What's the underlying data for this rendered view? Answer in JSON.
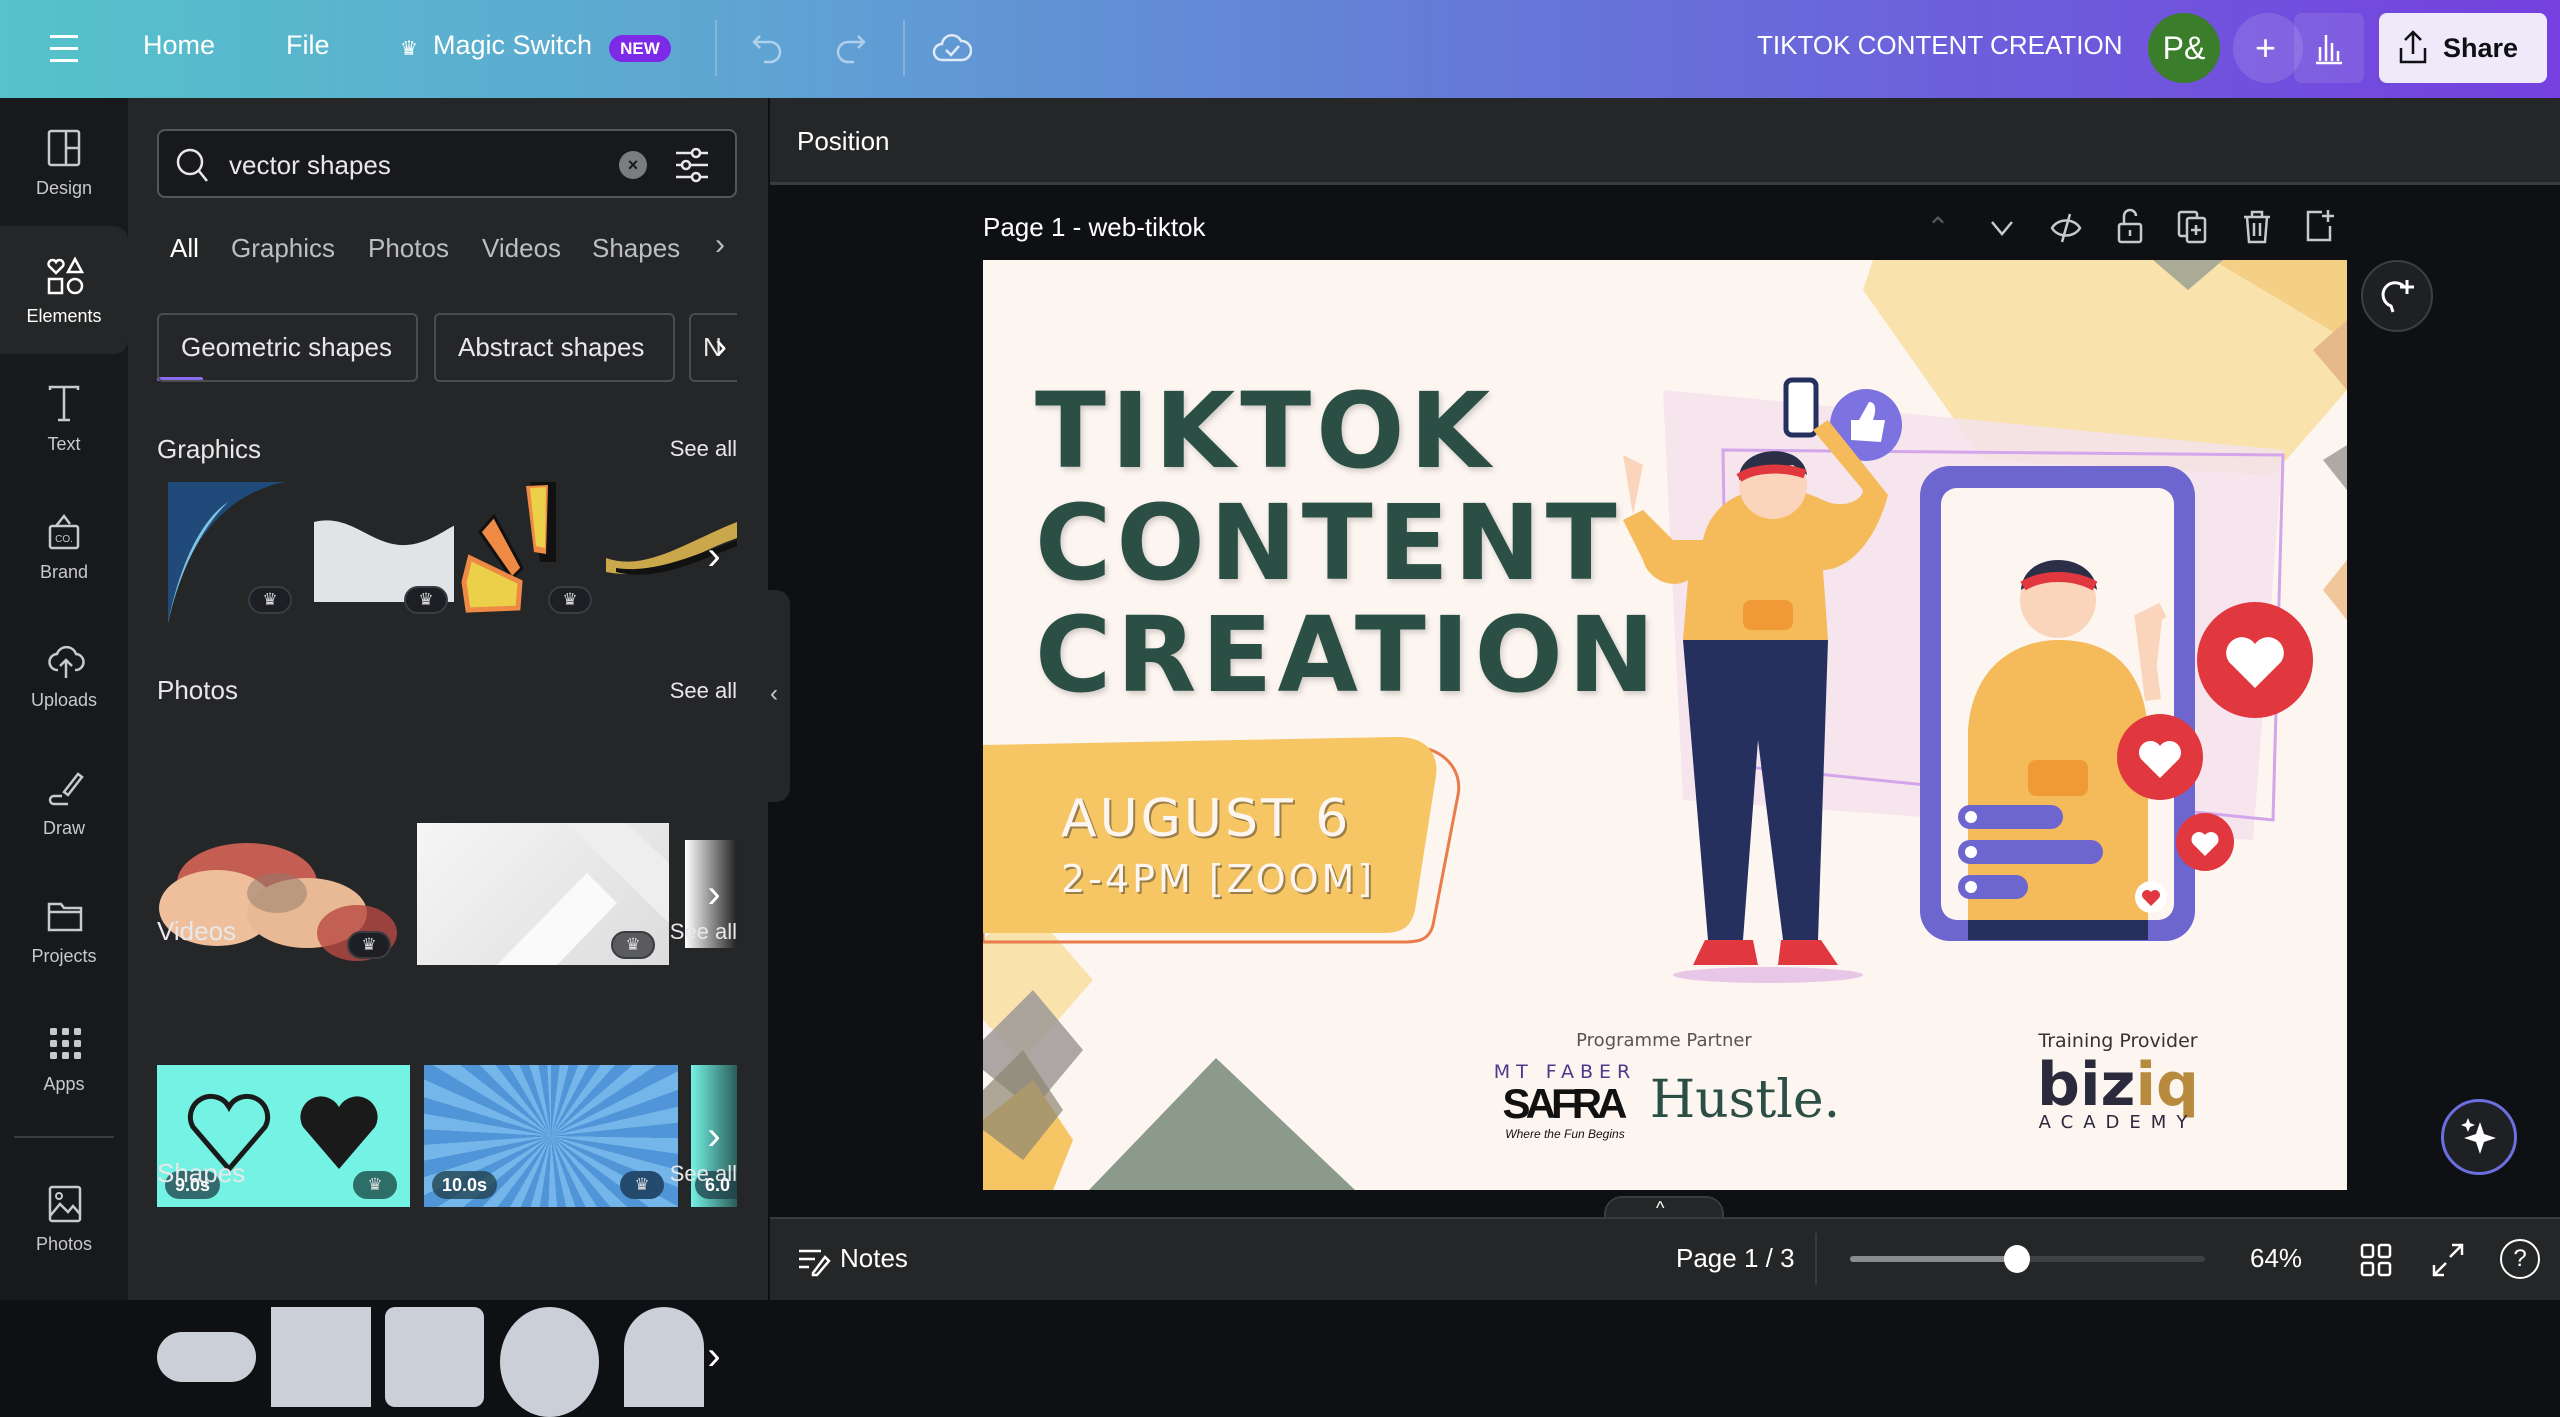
{
  "topbar": {
    "home": "Home",
    "file": "File",
    "magic_switch": "Magic Switch",
    "new_badge": "NEW",
    "document_title": "TIKTOK CONTENT CREATION",
    "avatar_initials": "P&",
    "share": "Share",
    "colors": {
      "gradient_start": "#55c3c9",
      "gradient_end": "#7540df",
      "avatar": "#3a7d2a",
      "share_bg": "#efe9fa"
    }
  },
  "rail": {
    "items": [
      {
        "label": "Design",
        "icon": "layout-icon"
      },
      {
        "label": "Elements",
        "icon": "shapes-icon",
        "active": true
      },
      {
        "label": "Text",
        "icon": "text-icon"
      },
      {
        "label": "Brand",
        "icon": "brand-icon"
      },
      {
        "label": "Uploads",
        "icon": "cloud-upload-icon"
      },
      {
        "label": "Draw",
        "icon": "pen-icon"
      },
      {
        "label": "Projects",
        "icon": "folder-icon"
      },
      {
        "label": "Apps",
        "icon": "apps-grid-icon"
      },
      {
        "label": "Photos",
        "icon": "image-icon"
      }
    ]
  },
  "panel": {
    "search_value": "vector shapes",
    "tabs": [
      "All",
      "Graphics",
      "Photos",
      "Videos",
      "Shapes"
    ],
    "active_tab": "All",
    "chips": [
      "Geometric shapes",
      "Abstract shapes",
      "N"
    ],
    "sections": {
      "graphics": {
        "title": "Graphics",
        "see_all": "See all"
      },
      "photos": {
        "title": "Photos",
        "see_all": "See all"
      },
      "videos": {
        "title": "Videos",
        "see_all": "See all",
        "durations": [
          "9.0s",
          "10.0s",
          "6.0"
        ]
      },
      "shapes": {
        "title": "Shapes",
        "see_all": "See all"
      }
    },
    "accent": "#8b6cf0"
  },
  "editor": {
    "position_label": "Position",
    "page_title": "Page 1 - web-tiktok"
  },
  "design": {
    "title_lines": [
      "TIKTOK",
      "CONTENT",
      "CREATION"
    ],
    "date": "AUGUST 6",
    "time": "2-4PM [ZOOM]",
    "partner_label": "Programme Partner",
    "safra_top": "MT FABER",
    "safra": "SAFRA",
    "safra_tag": "Where the Fun Begins",
    "hustle": "Hustle.",
    "provider_label": "Training Provider",
    "biziq_a": "biz",
    "biziq_b": "iq",
    "academy": "ACADEMY",
    "colors": {
      "title": "#2b4f45",
      "background": "#fdf5f0",
      "date_box": "#f6c564",
      "heart": "#e0383e",
      "phone": "#6e66cf"
    }
  },
  "bottombar": {
    "notes": "Notes",
    "page_indicator": "Page 1 / 3",
    "zoom_percent": "64%",
    "zoom_slider_fraction": 0.47
  }
}
